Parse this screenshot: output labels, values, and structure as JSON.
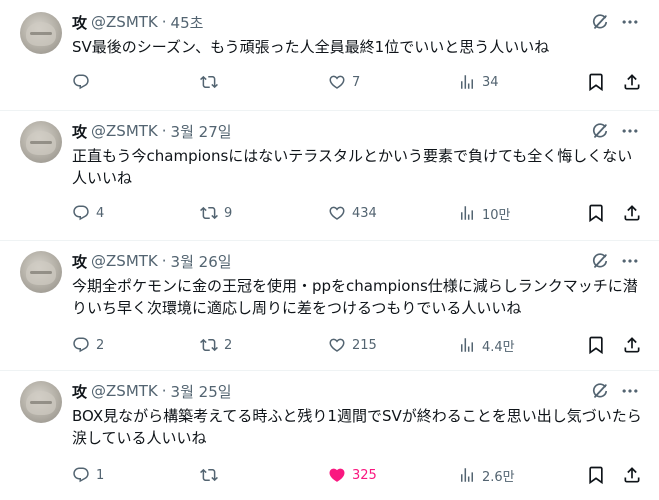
{
  "tweets": [
    {
      "name": "攻",
      "handle": "@ZSMTK",
      "dot": "·",
      "time": "45초",
      "text": "SV最後のシーズン、もう頑張った人全員最終1位でいいと思う人いいね",
      "replies": "",
      "retweets": "",
      "likes": "7",
      "views": "34",
      "liked": false
    },
    {
      "name": "攻",
      "handle": "@ZSMTK",
      "dot": "·",
      "time": "3월 27일",
      "text": "正直もう今championsにはないテラスタルとかいう要素で負けても全く悔しくない人いいね",
      "replies": "4",
      "retweets": "9",
      "likes": "434",
      "views": "10만",
      "liked": false
    },
    {
      "name": "攻",
      "handle": "@ZSMTK",
      "dot": "·",
      "time": "3월 26일",
      "text": "今期全ポケモンに金の王冠を使用・ppをchampions仕様に減らしランクマッチに潜りいち早く次環境に適応し周りに差をつけるつもりでいる人いいね",
      "replies": "2",
      "retweets": "2",
      "likes": "215",
      "views": "4.4만",
      "liked": false
    },
    {
      "name": "攻",
      "handle": "@ZSMTK",
      "dot": "·",
      "time": "3월 25일",
      "text": "BOX見ながら構築考えてる時ふと残り1週間でSVが終わることを思い出し気づいたら涙している人いいね",
      "replies": "1",
      "retweets": "",
      "likes": "325",
      "views": "2.6만",
      "liked": true
    }
  ],
  "colors": {
    "text": "#0f1419",
    "muted": "#536471",
    "like": "#f91880",
    "divider": "#eff3f4"
  },
  "icons": [
    "grok-icon",
    "more-icon",
    "reply-icon",
    "retweet-icon",
    "like-icon",
    "views-icon",
    "bookmark-icon",
    "share-icon"
  ]
}
